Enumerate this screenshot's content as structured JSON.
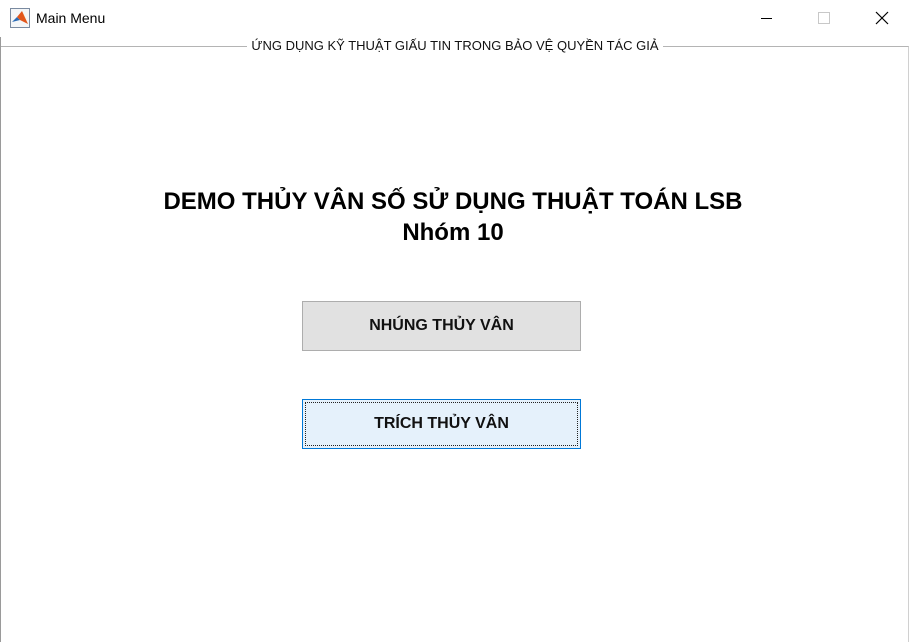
{
  "window": {
    "title": "Main Menu",
    "app_icon": "matlab-icon",
    "controls": {
      "minimize_icon": "minimize-icon",
      "maximize_icon": "maximize-icon",
      "close_icon": "close-icon"
    }
  },
  "panel": {
    "title": "ỨNG DỤNG KỸ THUẬT GIẤU TIN TRONG BẢO VỆ QUYỀN TÁC GIẢ"
  },
  "main": {
    "heading_line1": "DEMO THỦY VÂN SỐ SỬ DỤNG THUẬT TOÁN LSB",
    "heading_line2": "Nhóm 10",
    "embed_button_label": "NHÚNG THỦY VÂN",
    "extract_button_label": "TRÍCH THỦY VÂN"
  },
  "colors": {
    "button_face": "#e1e1e1",
    "focused_button_face": "#e5f1fb",
    "focus_border": "#0078d7"
  }
}
